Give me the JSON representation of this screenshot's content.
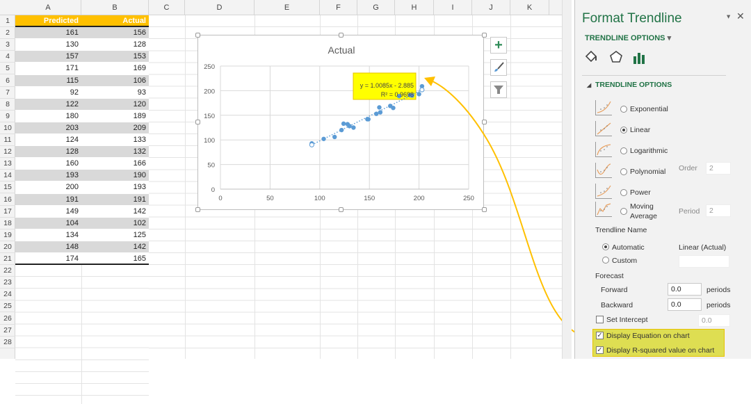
{
  "columns": [
    "A",
    "B",
    "C",
    "D",
    "E",
    "F",
    "G",
    "H",
    "I",
    "J",
    "K"
  ],
  "row_numbers": [
    1,
    2,
    3,
    4,
    5,
    6,
    7,
    8,
    9,
    10,
    11,
    12,
    13,
    14,
    15,
    16,
    17,
    18,
    19,
    20,
    21,
    22,
    23,
    24,
    25,
    26,
    27,
    28
  ],
  "table": {
    "headers": [
      "Predicted",
      "Actual"
    ],
    "rows": [
      [
        161,
        156
      ],
      [
        130,
        128
      ],
      [
        157,
        153
      ],
      [
        171,
        169
      ],
      [
        115,
        106
      ],
      [
        92,
        93
      ],
      [
        122,
        120
      ],
      [
        180,
        189
      ],
      [
        203,
        209
      ],
      [
        124,
        133
      ],
      [
        128,
        132
      ],
      [
        160,
        166
      ],
      [
        193,
        190
      ],
      [
        200,
        193
      ],
      [
        191,
        191
      ],
      [
        149,
        142
      ],
      [
        104,
        102
      ],
      [
        134,
        125
      ],
      [
        148,
        142
      ],
      [
        174,
        165
      ]
    ]
  },
  "colors": {
    "header_fill": "#ffc000",
    "band": "#d9d9d9",
    "point": "#5b9bd5",
    "accent": "#217346",
    "highlight": "#ffff00",
    "arrow": "#ffc000"
  },
  "chart_data": {
    "type": "scatter",
    "title": "Actual",
    "xlim": [
      0,
      250
    ],
    "ylim": [
      0,
      250
    ],
    "xticks": [
      0,
      50,
      100,
      150,
      200,
      250
    ],
    "yticks": [
      0,
      50,
      100,
      150,
      200,
      250
    ],
    "grid": true,
    "series": [
      {
        "name": "Actual",
        "x": [
          161,
          130,
          157,
          171,
          115,
          92,
          122,
          180,
          203,
          124,
          128,
          160,
          193,
          200,
          191,
          149,
          104,
          134,
          148,
          174
        ],
        "y": [
          156,
          128,
          153,
          169,
          106,
          93,
          120,
          189,
          209,
          133,
          132,
          166,
          190,
          193,
          191,
          142,
          102,
          125,
          142,
          165
        ]
      }
    ],
    "trendline": {
      "type": "linear",
      "slope": 1.0085,
      "intercept": -2.885,
      "x_range": [
        92,
        203
      ],
      "equation": "y = 1.0085x - 2.885",
      "r2": "R² = 0.9698"
    }
  },
  "chart_buttons": [
    "chart-elements",
    "chart-styles",
    "chart-filters"
  ],
  "pane": {
    "title": "Format Trendline",
    "section_dropdown": "TRENDLINE OPTIONS",
    "section": "TRENDLINE OPTIONS",
    "types": [
      {
        "label": "Exponential",
        "selected": false
      },
      {
        "label": "Linear",
        "selected": true
      },
      {
        "label": "Logarithmic",
        "selected": false
      },
      {
        "label": "Polynomial",
        "selected": false
      },
      {
        "label": "Power",
        "selected": false
      },
      {
        "label": "Moving",
        "label2": "Average",
        "selected": false
      }
    ],
    "order_label": "Order",
    "order_value": "2",
    "period_label": "Period",
    "period_value": "2",
    "name_label": "Trendline Name",
    "automatic": "Automatic",
    "automatic_value": "Linear (Actual)",
    "custom": "Custom",
    "custom_value": "",
    "forecast": "Forecast",
    "forward": "Forward",
    "forward_value": "0.0",
    "backward": "Backward",
    "backward_value": "0.0",
    "periods": "periods",
    "set_intercept": "Set Intercept",
    "intercept_value": "0.0",
    "display_equation": "Display Equation on chart",
    "display_r2": "Display R-squared value on chart",
    "check_mark": "✓"
  }
}
